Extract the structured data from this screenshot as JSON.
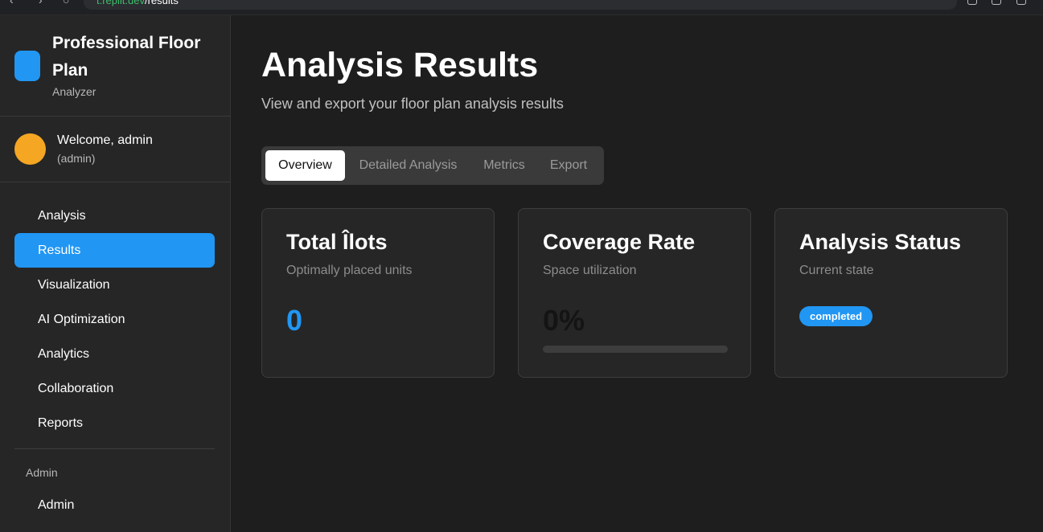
{
  "browser": {
    "url_host": "t.replit.dev",
    "url_path": "/results"
  },
  "sidebar": {
    "brand_title": "Professional Floor Plan",
    "brand_subtitle": "Analyzer",
    "user_welcome": "Welcome, admin",
    "user_role": "(admin)",
    "items": [
      {
        "label": "Analysis",
        "active": false
      },
      {
        "label": "Results",
        "active": true
      },
      {
        "label": "Visualization",
        "active": false
      },
      {
        "label": "AI Optimization",
        "active": false
      },
      {
        "label": "Analytics",
        "active": false
      },
      {
        "label": "Collaboration",
        "active": false
      },
      {
        "label": "Reports",
        "active": false
      }
    ],
    "admin_section_label": "Admin",
    "admin_item": "Admin"
  },
  "main": {
    "title": "Analysis Results",
    "subtitle": "View and export your floor plan analysis results",
    "tabs": [
      {
        "label": "Overview",
        "active": true
      },
      {
        "label": "Detailed Analysis",
        "active": false
      },
      {
        "label": "Metrics",
        "active": false
      },
      {
        "label": "Export",
        "active": false
      }
    ],
    "cards": {
      "ilots": {
        "title": "Total Îlots",
        "subtitle": "Optimally placed units",
        "value": "0"
      },
      "coverage": {
        "title": "Coverage Rate",
        "subtitle": "Space utilization",
        "value": "0%",
        "progress": 0
      },
      "status": {
        "title": "Analysis Status",
        "subtitle": "Current state",
        "badge": "completed"
      }
    }
  },
  "colors": {
    "accent": "#2196f3",
    "avatar": "#f5a623",
    "sidebar_bg": "#262626",
    "main_bg": "#1e1e1e"
  }
}
